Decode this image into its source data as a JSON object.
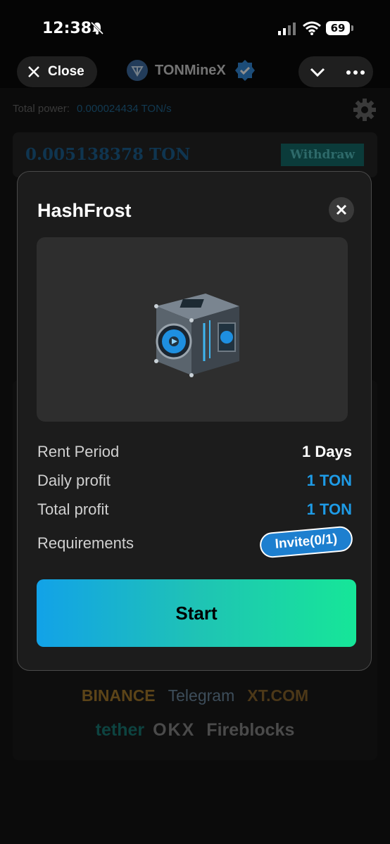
{
  "status_bar": {
    "time": "12:38",
    "battery": "69"
  },
  "header": {
    "close_label": "Close",
    "bot_name": "TONMineX"
  },
  "background": {
    "power_label": "Total power:",
    "power_value": "0.000024434 TON/s",
    "balance": "0.005138378 TON",
    "withdraw_label": "Withdraw",
    "partners": [
      "BINANCE",
      "Telegram",
      "XT.COM",
      "tether",
      "OKX",
      "Fireblocks"
    ]
  },
  "modal": {
    "title": "HashFrost",
    "rows": [
      {
        "label": "Rent Period",
        "value": "1 Days"
      },
      {
        "label": "Daily profit",
        "value": "1 TON"
      },
      {
        "label": "Total profit",
        "value": "1 TON"
      },
      {
        "label": "Requirements",
        "value": "Invite(0/1)"
      }
    ],
    "start_label": "Start"
  },
  "colors": {
    "accent_blue": "#1e9be6",
    "gradient_start": "#12a2e8",
    "gradient_end": "#16e698",
    "modal_bg": "#1c1c1c"
  }
}
